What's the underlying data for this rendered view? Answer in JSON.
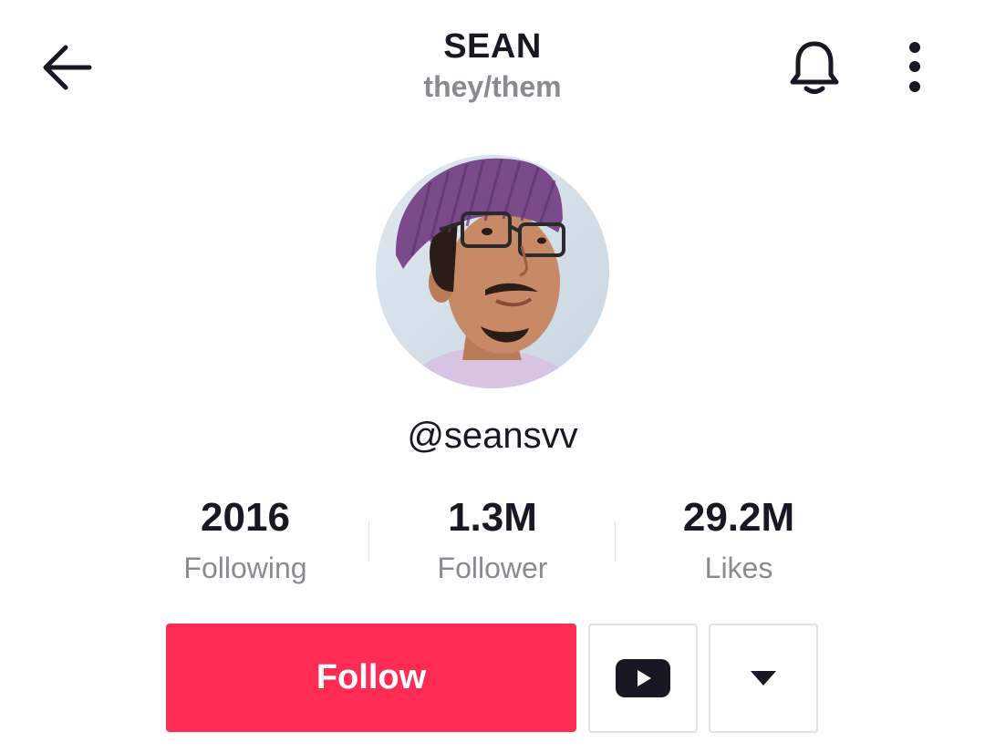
{
  "header": {
    "title": "SEAN",
    "pronouns": "they/them",
    "back_icon": "arrow-left-icon",
    "bell_icon": "bell-icon",
    "more_icon": "vertical-ellipsis-icon"
  },
  "profile": {
    "avatar_icon": "profile-photo",
    "handle": "@seansvv"
  },
  "stats": [
    {
      "value": "2016",
      "label": "Following"
    },
    {
      "value": "1.3M",
      "label": "Follower"
    },
    {
      "value": "29.2M",
      "label": "Likes"
    }
  ],
  "actions": {
    "follow_label": "Follow",
    "youtube_icon": "youtube-icon",
    "dropdown_icon": "caret-down-icon"
  },
  "colors": {
    "accent": "#fe2c55",
    "text_primary": "#161823",
    "text_secondary": "#8a8b91",
    "border": "#e3e3e4"
  }
}
